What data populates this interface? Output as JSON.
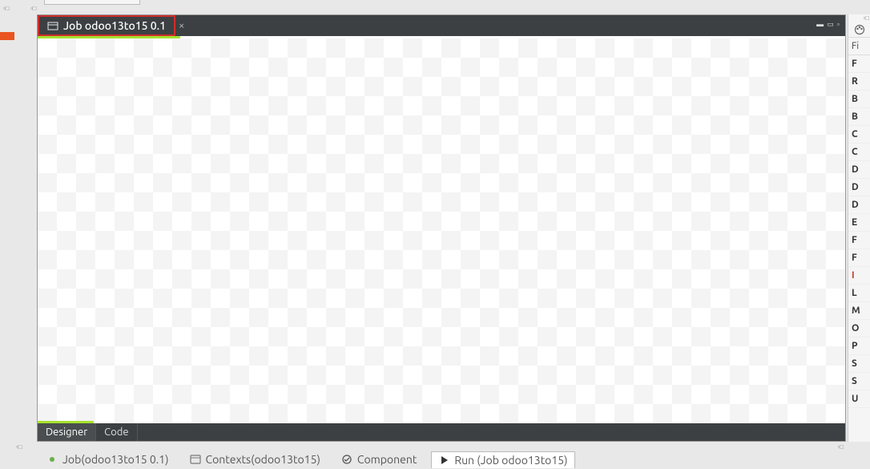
{
  "tab": {
    "icon": "job-icon",
    "label": "Job odoo13to15 0.1"
  },
  "window_controls": "▬ ▭ ▫",
  "bottom_tabs": {
    "designer": "Designer",
    "code": "Code"
  },
  "bottom_views": {
    "job": {
      "label": "Job(odoo13to15 0.1)"
    },
    "contexts": {
      "label": "Contexts(odoo13to15)"
    },
    "component": {
      "label": "Component"
    },
    "run": {
      "label": "Run (Job odoo13to15)"
    }
  },
  "palette": {
    "find_label": "Fi",
    "rows": [
      "F",
      "R",
      "B",
      "B",
      "C",
      "C",
      "D",
      "D",
      "D",
      "E",
      "F",
      "F",
      "I",
      "L",
      "M",
      "O",
      "P",
      "S",
      "S",
      "U"
    ],
    "highlight_index": 12
  },
  "dotted_marker": "▫ □"
}
